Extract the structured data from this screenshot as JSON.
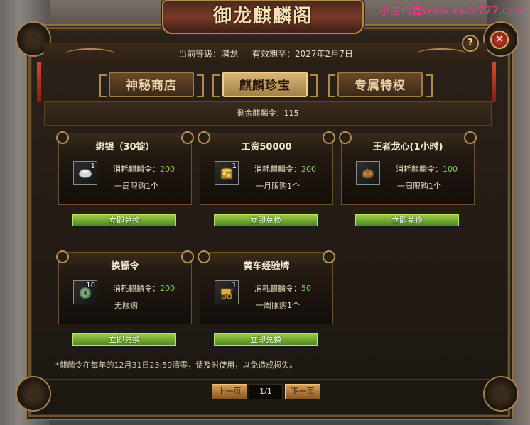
{
  "watermark": "小雪代售www.xxds777.com",
  "title": "御龙麒麟阁",
  "status": {
    "level_label": "当前等级：潜龙",
    "expiry_label": "有效期至：2027年2月7日"
  },
  "tabs": [
    {
      "label": "神秘商店",
      "active": false
    },
    {
      "label": "麒麟珍宝",
      "active": true
    },
    {
      "label": "专属特权",
      "active": false
    }
  ],
  "remaining": "剩余麒麟令：115",
  "items": [
    {
      "name": "绑银（30锭）",
      "count": "1",
      "cost_label": "消耗麒麟令：",
      "cost": "200",
      "limit": "一周限购1个",
      "button": "立即兑换",
      "icon": "silver-ingot-icon"
    },
    {
      "name": "工资50000",
      "count": "1",
      "cost_label": "消耗麒麟令：",
      "cost": "200",
      "limit": "一月限购1个",
      "button": "立即兑换",
      "icon": "gold-coins-icon"
    },
    {
      "name": "王者龙心(1小时)",
      "count": "",
      "cost_label": "消耗麒麟令：",
      "cost": "100",
      "limit": "一周限购1个",
      "button": "立即兑换",
      "icon": "dragon-heart-icon"
    },
    {
      "name": "换镖令",
      "count": "10",
      "cost_label": "消耗麒麟令：",
      "cost": "200",
      "limit": "无限购",
      "button": "立即兑换",
      "icon": "escort-token-icon"
    },
    {
      "name": "黄车经验牌",
      "count": "1",
      "cost_label": "消耗麒麟令：",
      "cost": "50",
      "limit": "一周限购1个",
      "button": "立即兑换",
      "icon": "yellow-cart-icon"
    }
  ],
  "note": "*麒麟令在每年的12月31日23:59清零，请及时使用，以免造成损失。",
  "pagination": {
    "prev": "上一页",
    "page": "1/1",
    "next": "下一页"
  },
  "buttons": {
    "help": "?",
    "close": "✕"
  }
}
